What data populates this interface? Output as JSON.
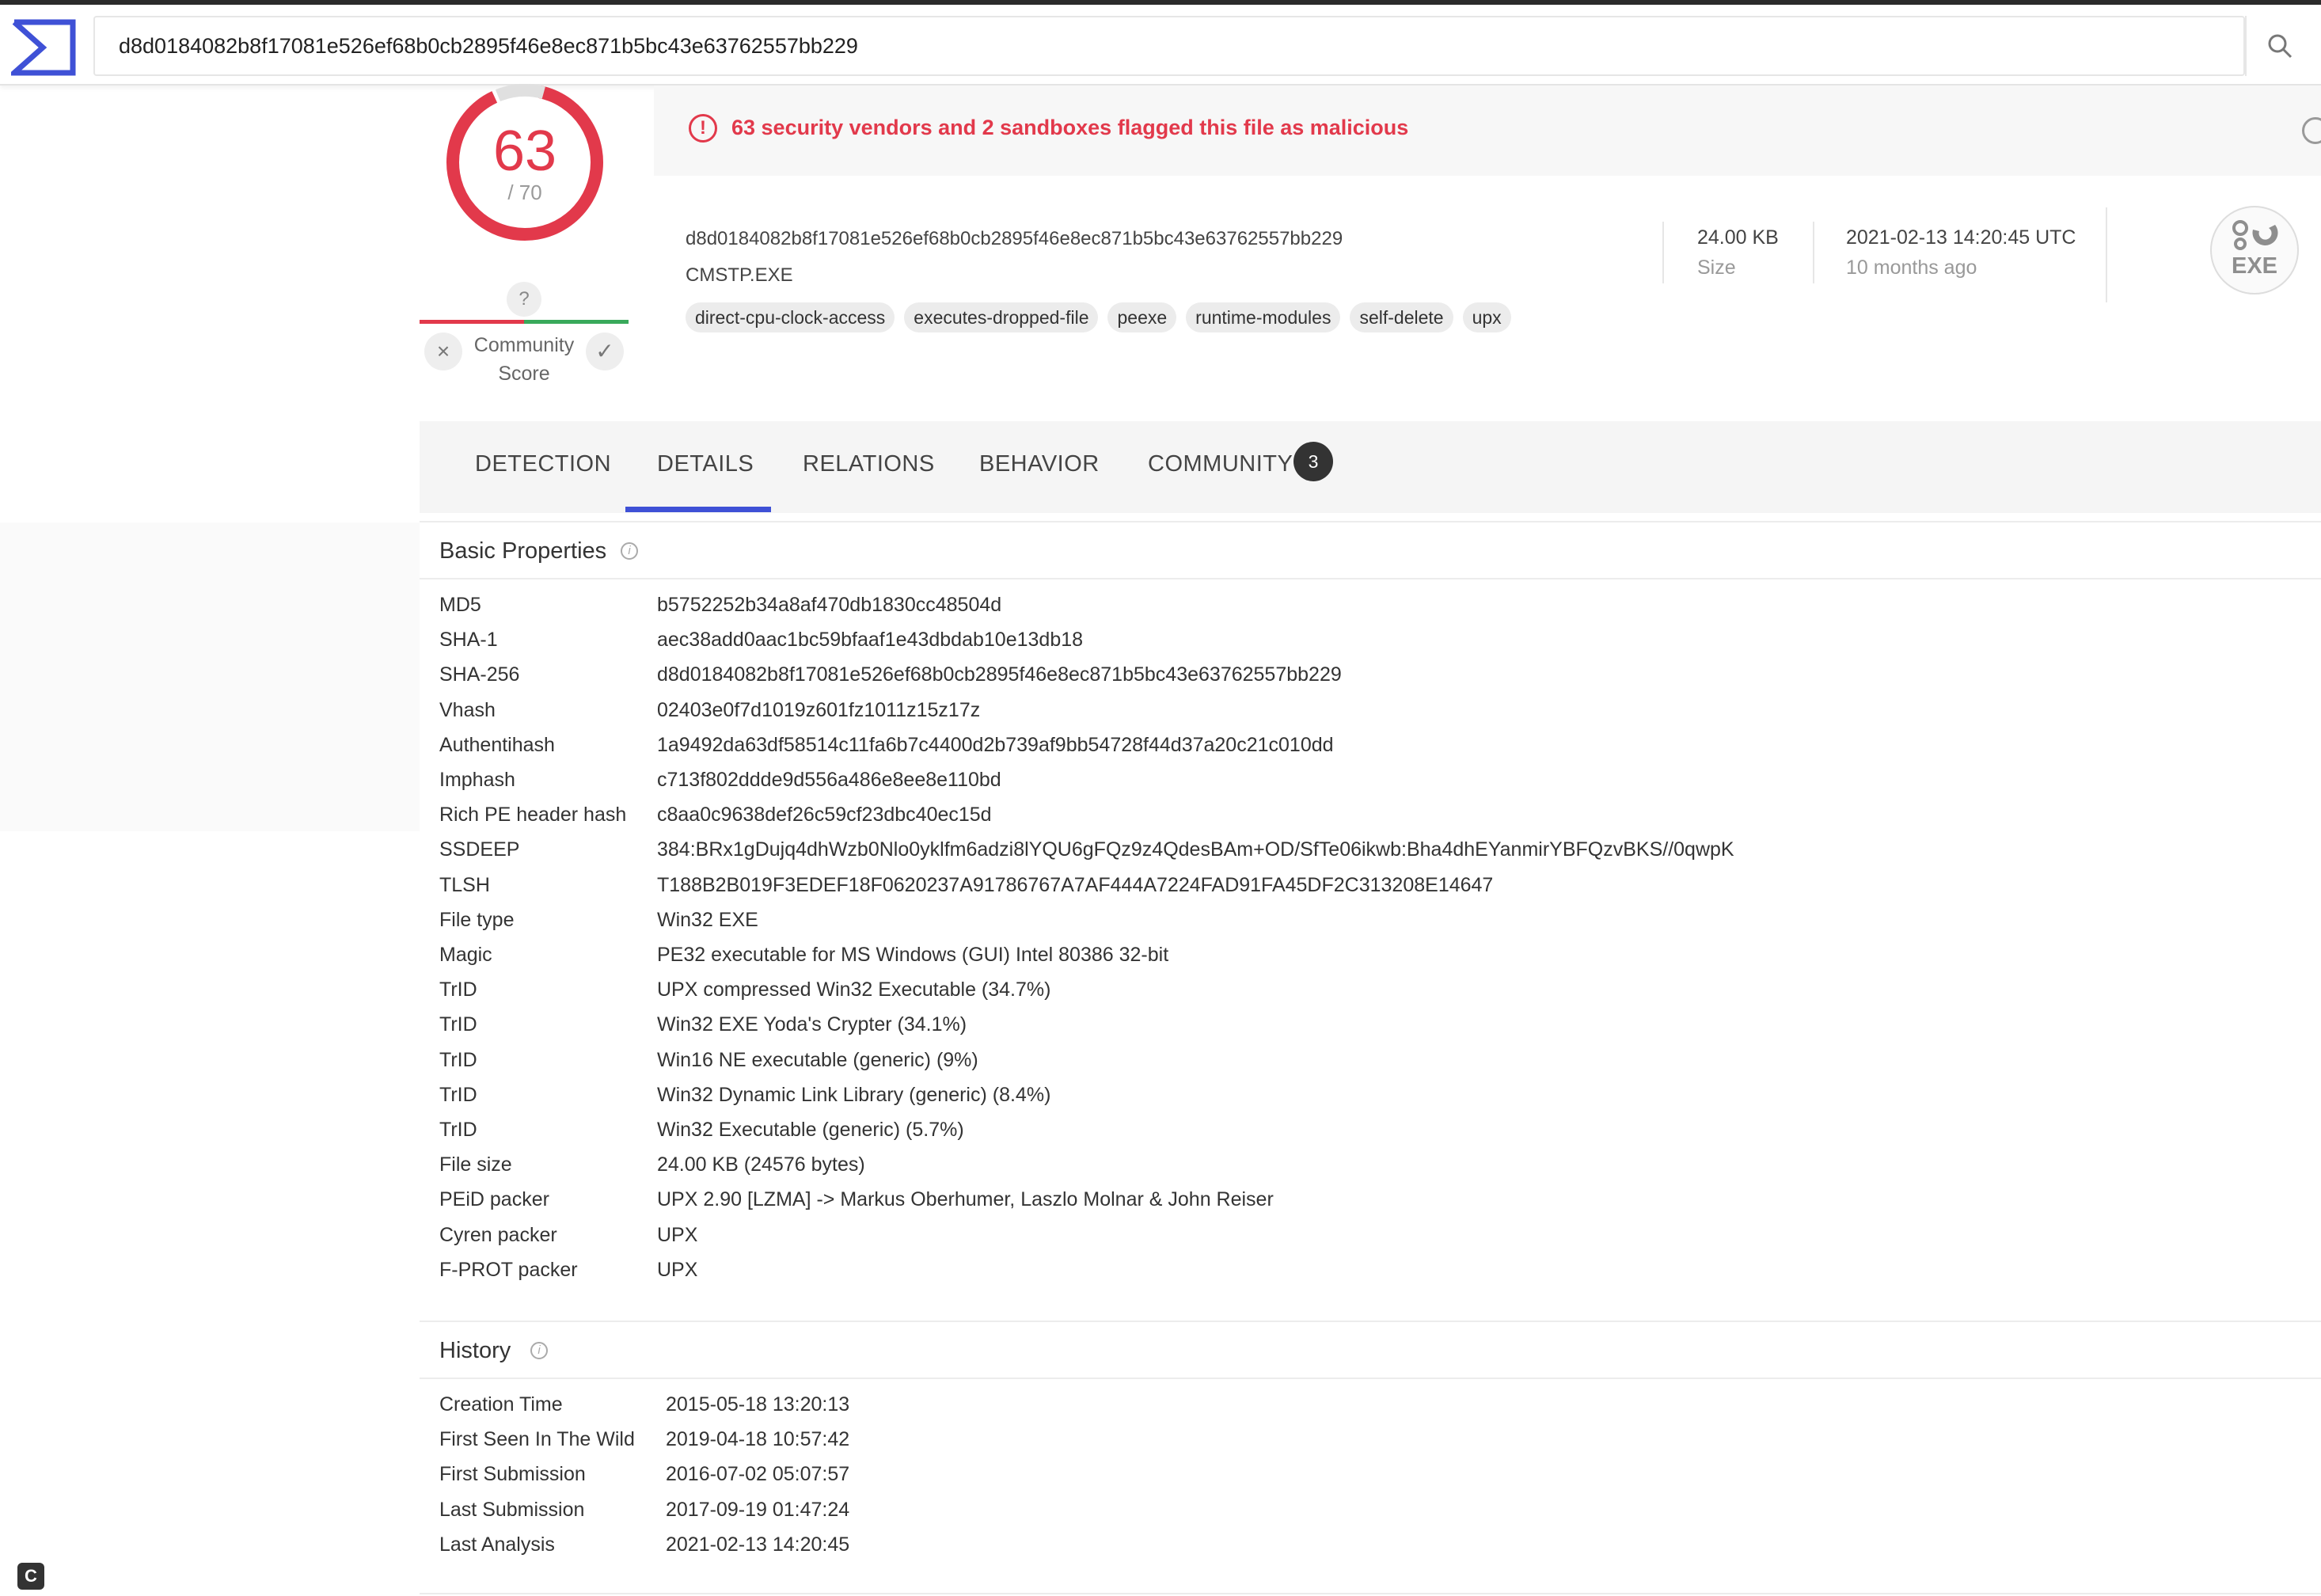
{
  "search": {
    "value": "d8d0184082b8f17081e526ef68b0cb2895f46e8ec871b5bc43e63762557bb229"
  },
  "score": {
    "detections": "63",
    "total": "/ 70",
    "community_question": "?",
    "community_label": "Community Score"
  },
  "alert": {
    "text": "63 security vendors and 2 sandboxes flagged this file as malicious"
  },
  "file": {
    "hash": "d8d0184082b8f17081e526ef68b0cb2895f46e8ec871b5bc43e63762557bb229",
    "name": "CMSTP.EXE",
    "tags": [
      "direct-cpu-clock-access",
      "executes-dropped-file",
      "peexe",
      "runtime-modules",
      "self-delete",
      "upx"
    ],
    "size_value": "24.00 KB",
    "size_label": "Size",
    "date_value": "2021-02-13 14:20:45 UTC",
    "date_label": "10 months ago",
    "type_badge": "EXE"
  },
  "tabs": [
    {
      "label": "DETECTION"
    },
    {
      "label": "DETAILS"
    },
    {
      "label": "RELATIONS"
    },
    {
      "label": "BEHAVIOR"
    },
    {
      "label": "COMMUNITY",
      "badge": "3"
    }
  ],
  "basic_properties": {
    "title": "Basic Properties",
    "rows": [
      {
        "label": "MD5",
        "value": "b5752252b34a8af470db1830cc48504d"
      },
      {
        "label": "SHA-1",
        "value": "aec38add0aac1bc59bfaaf1e43dbdab10e13db18"
      },
      {
        "label": "SHA-256",
        "value": "d8d0184082b8f17081e526ef68b0cb2895f46e8ec871b5bc43e63762557bb229"
      },
      {
        "label": "Vhash",
        "value": "02403e0f7d1019z601fz1011z15z17z"
      },
      {
        "label": "Authentihash",
        "value": "1a9492da63df58514c11fa6b7c4400d2b739af9bb54728f44d37a20c21c010dd"
      },
      {
        "label": "Imphash",
        "value": "c713f802ddde9d556a486e8ee8e110bd"
      },
      {
        "label": "Rich PE header hash",
        "value": "c8aa0c9638def26c59cf23dbc40ec15d"
      },
      {
        "label": "SSDEEP",
        "value": "384:BRx1gDujq4dhWzb0Nlo0yklfm6adzi8lYQU6gFQz9z4QdesBAm+OD/SfTe06ikwb:Bha4dhEYanmirYBFQzvBKS//0qwpK"
      },
      {
        "label": "TLSH",
        "value": "T188B2B019F3EDEF18F0620237A91786767A7AF444A7224FAD91FA45DF2C313208E14647"
      },
      {
        "label": "File type",
        "value": "Win32 EXE"
      },
      {
        "label": "Magic",
        "value": "PE32 executable for MS Windows (GUI) Intel 80386 32-bit"
      },
      {
        "label": "TrID",
        "value": "UPX compressed Win32 Executable (34.7%)"
      },
      {
        "label": "TrID",
        "value": "Win32 EXE Yoda's Crypter (34.1%)"
      },
      {
        "label": "TrID",
        "value": "Win16 NE executable (generic) (9%)"
      },
      {
        "label": "TrID",
        "value": "Win32 Dynamic Link Library (generic) (8.4%)"
      },
      {
        "label": "TrID",
        "value": "Win32 Executable (generic) (5.7%)"
      },
      {
        "label": "File size",
        "value": "24.00 KB (24576 bytes)"
      },
      {
        "label": "PEiD packer",
        "value": "UPX 2.90 [LZMA] -> Markus Oberhumer, Laszlo Molnar & John Reiser"
      },
      {
        "label": "Cyren packer",
        "value": "UPX"
      },
      {
        "label": "F-PROT packer",
        "value": "UPX"
      }
    ]
  },
  "history": {
    "title": "History",
    "rows": [
      {
        "label": "Creation Time",
        "value": "2015-05-18 13:20:13"
      },
      {
        "label": "First Seen In The Wild",
        "value": "2019-04-18 10:57:42"
      },
      {
        "label": "First Submission",
        "value": "2016-07-02 05:07:57"
      },
      {
        "label": "Last Submission",
        "value": "2017-09-19 01:47:24"
      },
      {
        "label": "Last Analysis",
        "value": "2021-02-13 14:20:45"
      }
    ]
  },
  "colors": {
    "malicious": "#e2394b",
    "accent": "#3f51d6",
    "benign": "#39a95b"
  },
  "corner_badge": "C"
}
